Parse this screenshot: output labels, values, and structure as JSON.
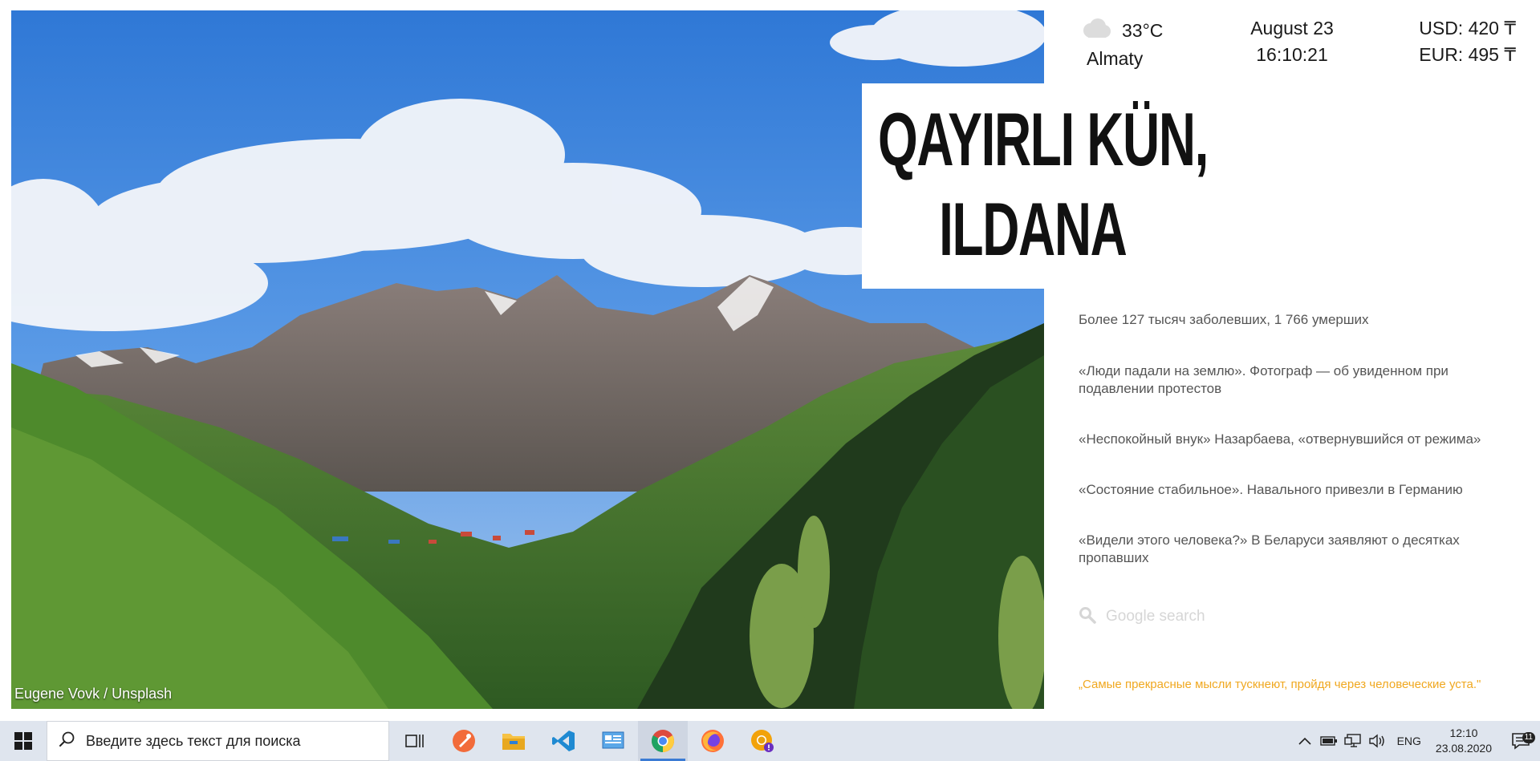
{
  "photo": {
    "credit": "Eugene Vovk / Unsplash"
  },
  "greeting": {
    "line1": "QAYIRLI KÜN,",
    "line2": "ILDANA"
  },
  "weather": {
    "icon": "cloud-icon",
    "temperature": "33°C",
    "city": "Almaty"
  },
  "clock": {
    "date": "August 23",
    "time": "16:10:21"
  },
  "rates": {
    "usd": "USD: 420 ₸",
    "eur": "EUR: 495 ₸"
  },
  "news": [
    "Более 127 тысяч заболевших, 1 766 умерших",
    "«Люди падали на землю». Фотограф — об увиденном при подавлении протестов",
    "«Неспокойный внук» Назарбаева, «отвернувшийся от режима»",
    "«Состояние стабильное». Навального привезли в Германию",
    "«Видели этого человека?» В Беларуси заявляют о десятках пропавших"
  ],
  "search": {
    "placeholder": "Google search"
  },
  "quote": "„Самые прекрасные мысли тускнеют, пройдя через человеческие уста.\"",
  "taskbar": {
    "search_placeholder": "Введите здесь текст для поиска",
    "pinned": [
      "task-view-icon",
      "postman-icon",
      "file-explorer-icon",
      "vscode-icon",
      "control-panel-icon",
      "chrome-icon",
      "firefox-icon",
      "chrome-canary-icon"
    ],
    "active_app": "chrome-icon",
    "language": "ENG",
    "time": "12:10",
    "date": "23.08.2020",
    "notifications": "11"
  },
  "colors": {
    "accent_quote": "#f0a820",
    "taskbar_bg": "#dfe5ee",
    "taskbar_active": "#3b7bd4"
  }
}
